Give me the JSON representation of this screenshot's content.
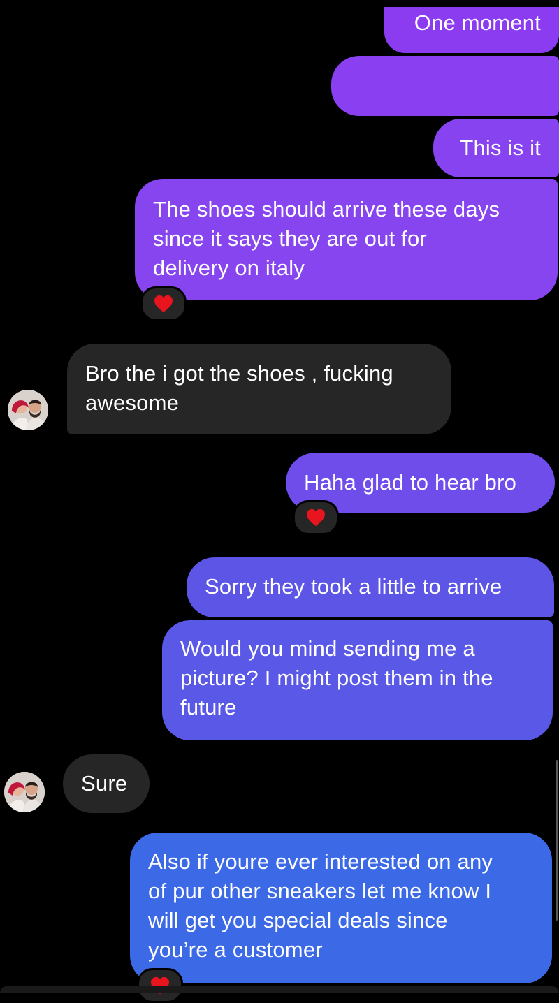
{
  "messages": [
    {
      "from": "me",
      "text": "One moment"
    },
    {
      "from": "me",
      "text": ""
    },
    {
      "from": "me",
      "text": "This is it"
    },
    {
      "from": "me",
      "text": "The shoes should arrive these days since it says they are out for delivery on italy",
      "lines": [
        "The shoes should arrive these days",
        "since it says they are out for",
        "delivery on italy"
      ],
      "reaction": "❤️"
    },
    {
      "from": "them",
      "lines": [
        "Bro the i got the shoes , fucking",
        "awesome"
      ]
    },
    {
      "from": "me",
      "text": "Haha glad to hear bro",
      "reaction": "❤️"
    },
    {
      "from": "me",
      "text": "Sorry they took a little to arrive"
    },
    {
      "from": "me",
      "lines": [
        "Would you mind sending me a",
        "picture? I might post them in the",
        "future"
      ]
    },
    {
      "from": "them",
      "text": "Sure"
    },
    {
      "from": "me",
      "lines": [
        "Also if youre ever interested on any",
        "of pur other sneakers let me know I",
        "will get you special deals since",
        "you’re a customer"
      ],
      "reaction": "❤️"
    }
  ],
  "avatar_icon": "profile-avatar",
  "reaction_icon": "heart-icon",
  "colors": {
    "bubble_violet": "#8a3ff0",
    "bubble_indigo": "#5b56e6",
    "bubble_blue": "#3c6ae6",
    "incoming": "#262626",
    "heart": "#e8141e"
  }
}
